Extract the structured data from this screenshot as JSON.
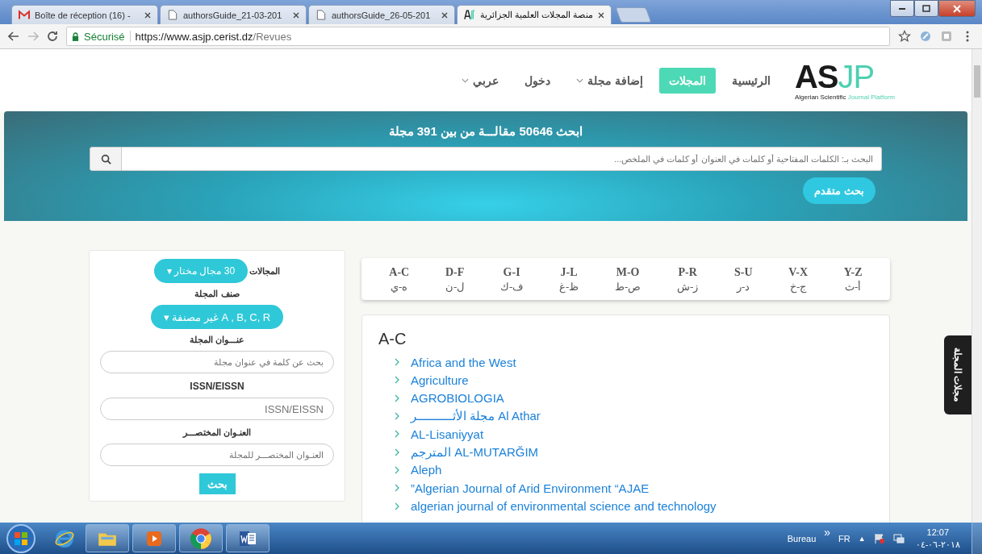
{
  "browser": {
    "tabs": [
      {
        "title": "منصة المجلات العلمية الجزائرية",
        "selected": true
      },
      {
        "title": "authorsGuide_26-05-201",
        "selected": false
      },
      {
        "title": "authorsGuide_21-03-201",
        "selected": false
      },
      {
        "title": "Boîte de réception (16) -",
        "selected": false
      }
    ],
    "secure_label": "Sécurisé",
    "url_host": "https://www.asjp.cerist.dz",
    "url_path": "/Revues"
  },
  "header": {
    "logo_dark": "AS",
    "logo_accent": "JP",
    "tagline_dark": "Algerian Scientific",
    "tagline_accent": "Journal Platform",
    "nav": [
      {
        "label": "الرئيسية",
        "selected": false,
        "dropdown": false
      },
      {
        "label": "المجلات",
        "selected": true,
        "dropdown": false
      },
      {
        "label": "إضافة مجلة",
        "selected": false,
        "dropdown": true
      },
      {
        "label": "دخول",
        "selected": false,
        "dropdown": false
      },
      {
        "label": "عربي",
        "selected": false,
        "dropdown": true
      }
    ]
  },
  "banner": {
    "title": "ابحث 50646 مقالـــة من بين 391 مجلة",
    "search_placeholder": "البحث بـ: الكلمات المفتاحية أو كلمات في العنوان أو كلمات في الملخص...",
    "advanced_button": "بحث متقدم"
  },
  "filters": {
    "fields_label": "المجالات",
    "fields_button": "30 مجال مختار ▾",
    "class_label": "صنف المجلة",
    "class_button": "A , B, C, R غير مصنفة ▾",
    "inputs": [
      {
        "label": "عنـــوان المجلة",
        "placeholder": "بحث عن كلمة في عنوان مجلة",
        "latin": false
      },
      {
        "label": "ISSN/EISSN",
        "placeholder": "ISSN/EISSN",
        "latin": true
      },
      {
        "label": "العنـوان المختصـــر",
        "placeholder": "العنـوان المختصـــر للمجلة",
        "latin": false
      }
    ],
    "search_button": "بحث"
  },
  "letters": [
    {
      "latin": "Y-Z",
      "arabic": "أ-ث"
    },
    {
      "latin": "V-X",
      "arabic": "ج-خ"
    },
    {
      "latin": "S-U",
      "arabic": "د-ر"
    },
    {
      "latin": "P-R",
      "arabic": "ز-ش"
    },
    {
      "latin": "M-O",
      "arabic": "ص-ط"
    },
    {
      "latin": "J-L",
      "arabic": "ظ-غ"
    },
    {
      "latin": "G-I",
      "arabic": "ف-ك"
    },
    {
      "latin": "D-F",
      "arabic": "ل-ن"
    },
    {
      "latin": "A-C",
      "arabic": "ه-ي"
    }
  ],
  "journals": {
    "heading": "A-C",
    "items": [
      "Africa and the West",
      "Agriculture",
      "AGROBIOLOGIA",
      "مجلة الأثـــــــــــر Al Athar",
      "AL-Lisaniyyat",
      "المترجم AL-MUTARĞIM",
      "Aleph",
      "”Algerian Journal of Arid Environment “AJAE",
      "algerian journal of environmental science and technology"
    ]
  },
  "side_tab": "مجلات المجلة",
  "taskbar": {
    "desktop_label": "Bureau",
    "more": "»",
    "language": "FR",
    "tray_arrow": "▲",
    "time": "12:07",
    "date": "٢٠١٨-٠٦-٠٤"
  }
}
